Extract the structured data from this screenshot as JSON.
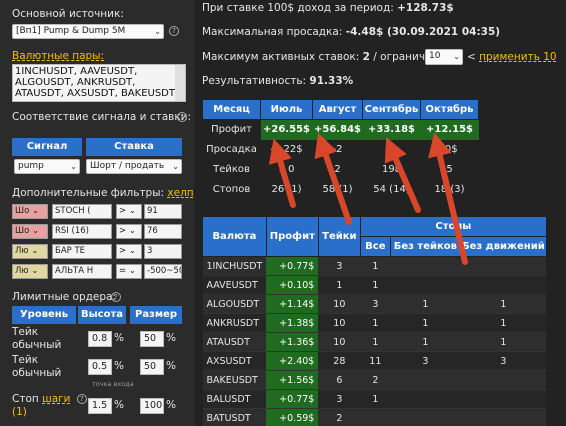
{
  "left": {
    "source_label": "Основной источник:",
    "source_value": "[Вп1] Pump & Dump 5M",
    "pairs_label": "Валютные пары:",
    "pairs_text": [
      "1INCHUSDT, AAVEUSDT,",
      "ALGOUSDT, ANKRUSDT,",
      "ATAUSDT, AXSUSDT, BAKEUSDT"
    ],
    "match_label": "Соответствие сигнала и ставки:",
    "signal_hd": "Сигнал",
    "stake_hd": "Ставка",
    "signal_value": "pump",
    "stake_value": "Шорт / продать",
    "filters_label": "Дополнительные фильтры:",
    "filters_link": "хелп",
    "filters": [
      {
        "tag": "Шо",
        "ind": "STOCH (",
        "op": ">",
        "val": "91",
        "color": "#e8a0a0"
      },
      {
        "tag": "Шо",
        "ind": "RSI (16)",
        "op": ">",
        "val": "76",
        "color": "#e8a0a0"
      },
      {
        "tag": "Лю",
        "ind": "БАР ТЕ",
        "op": ">",
        "val": "3",
        "color": "#e0d8a0"
      },
      {
        "tag": "Лю",
        "ind": "АЛЬТА Н",
        "op": "=",
        "val": "-500~50",
        "color": "#e0d8a0"
      }
    ],
    "limit_label": "Лимитные ордера:",
    "level_hd": "Уровень",
    "height_hd": "Высота",
    "size_hd": "Размер",
    "rows": [
      {
        "name1": "Тейк",
        "name2": "обычный",
        "height": "0.8",
        "size": "50"
      },
      {
        "name1": "Тейк",
        "name2": "обычный",
        "height": "0.5",
        "size": "50"
      }
    ],
    "entry_note": "точка входа",
    "stop_label": "Стоп",
    "stop_link": "шаги",
    "stop_count": "(1)",
    "stop_height": "1.5",
    "stop_size": "100",
    "pct": "%"
  },
  "right": {
    "income_label": "При ставке 100$ доход за период:",
    "income_value": "+128.73$",
    "drawdown_label": "Максимальная просадка:",
    "drawdown_value": "-4.48$ (30.09.2021 04:35)",
    "max_active_label": "Максимум активных ставок:",
    "max_active_value": "2",
    "limit_text": "/ ограничить",
    "limit_select": "10",
    "apply_link": "применить 10",
    "perf_label": "Результативность:",
    "perf_value": "91.33%",
    "months_header": [
      "Месяц",
      "Июль",
      "Август",
      "Сентябрь",
      "Октябрь"
    ],
    "months_rows": [
      {
        "label": "Профит",
        "cells": [
          "+26.55$",
          "+56.84$",
          "+33.18$",
          "+12.15$"
        ]
      },
      {
        "label": "Просадка",
        "cells": [
          "-3.22$",
          "-2",
          "-4.",
          "-0$"
        ]
      },
      {
        "label": "Тейков",
        "cells": [
          "1 0",
          "2",
          "198",
          "5"
        ]
      },
      {
        "label": "Стопов",
        "cells": [
          "26 (1)",
          "58 (1)",
          "54 (14)",
          "18 (3)"
        ]
      }
    ],
    "cur_header": {
      "valuta": "Валюта",
      "profit": "Профит",
      "takes": "Тейки",
      "stops": "Стопы",
      "all": "Все",
      "no_takes": "Без тейков",
      "no_moves": "Без движений"
    },
    "cur_rows": [
      {
        "pair": "1INCHUSDT",
        "profit": "+0.77$",
        "takes": "3",
        "all": "1",
        "nt": "",
        "nm": ""
      },
      {
        "pair": "AAVEUSDT",
        "profit": "+0.10$",
        "takes": "1",
        "all": "1",
        "nt": "",
        "nm": ""
      },
      {
        "pair": "ALGOUSDT",
        "profit": "+1.14$",
        "takes": "10",
        "all": "3",
        "nt": "1",
        "nm": "1"
      },
      {
        "pair": "ANKRUSDT",
        "profit": "+1.38$",
        "takes": "10",
        "all": "1",
        "nt": "1",
        "nm": "1"
      },
      {
        "pair": "ATAUSDT",
        "profit": "+1.36$",
        "takes": "10",
        "all": "1",
        "nt": "1",
        "nm": "1"
      },
      {
        "pair": "AXSUSDT",
        "profit": "+2.40$",
        "takes": "28",
        "all": "11",
        "nt": "3",
        "nm": "3"
      },
      {
        "pair": "BAKEUSDT",
        "profit": "+1.56$",
        "takes": "6",
        "all": "2",
        "nt": "",
        "nm": ""
      },
      {
        "pair": "BALUSDT",
        "profit": "+0.77$",
        "takes": "3",
        "all": "1",
        "nt": "",
        "nm": ""
      },
      {
        "pair": "BATUSDT",
        "profit": "+0.59$",
        "takes": "2",
        "all": "",
        "nt": "",
        "nm": ""
      }
    ]
  }
}
